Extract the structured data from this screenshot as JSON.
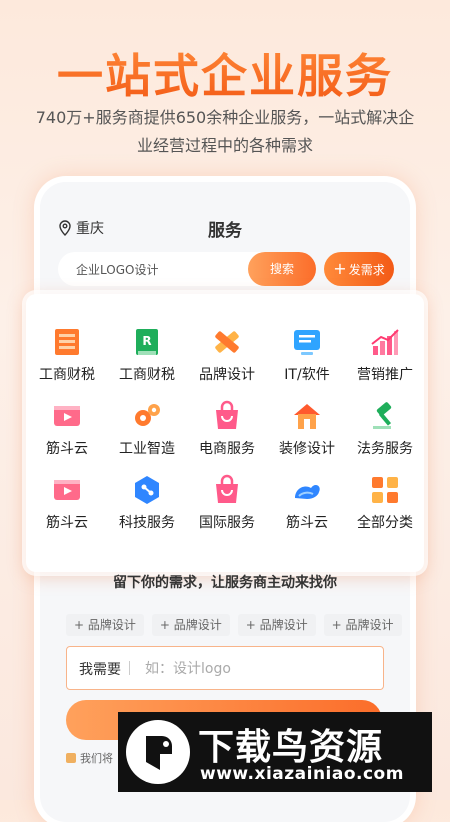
{
  "hero": {
    "title": "一站式企业服务",
    "subtitle_line1": "740万+服务商提供650余种企业服务，一站式解决企",
    "subtitle_line2": "业经营过程中的各种需求"
  },
  "header": {
    "location": "重庆",
    "title": "服务",
    "search_value": "企业LOGO设计",
    "search_button": "搜索",
    "post_button": "发需求"
  },
  "categories": [
    {
      "label": "工商财税",
      "icon": "building-icon"
    },
    {
      "label": "工商财税",
      "icon": "ledger-icon"
    },
    {
      "label": "品牌设计",
      "icon": "pencil-ruler-icon"
    },
    {
      "label": "IT/软件",
      "icon": "monitor-icon"
    },
    {
      "label": "营销推广",
      "icon": "bar-chart-icon"
    },
    {
      "label": "筋斗云",
      "icon": "play-icon"
    },
    {
      "label": "工业智造",
      "icon": "gears-icon"
    },
    {
      "label": "电商服务",
      "icon": "shopping-bag-icon"
    },
    {
      "label": "装修设计",
      "icon": "house-icon"
    },
    {
      "label": "法务服务",
      "icon": "gavel-icon"
    },
    {
      "label": "筋斗云",
      "icon": "play-icon"
    },
    {
      "label": "科技服务",
      "icon": "hexagon-network-icon"
    },
    {
      "label": "国际服务",
      "icon": "shopping-bag-icon"
    },
    {
      "label": "筋斗云",
      "icon": "cloud-icon"
    },
    {
      "label": "全部分类",
      "icon": "grid-icon"
    }
  ],
  "request": {
    "title": "留下你的需求，让服务商主动来找你",
    "tags": [
      "+ 品牌设计",
      "+ 品牌设计",
      "+ 品牌设计",
      "+ 品牌设计"
    ],
    "need_label": "我需要",
    "need_placeholder": "如：设计logo",
    "notice": "我们将"
  },
  "watermark": {
    "name": "下载鸟资源",
    "url": "www.xiazainiao.com"
  },
  "colors": {
    "accent": "#fb6d2a",
    "accent_light": "#ffa15c",
    "background": "#fdeee4"
  }
}
